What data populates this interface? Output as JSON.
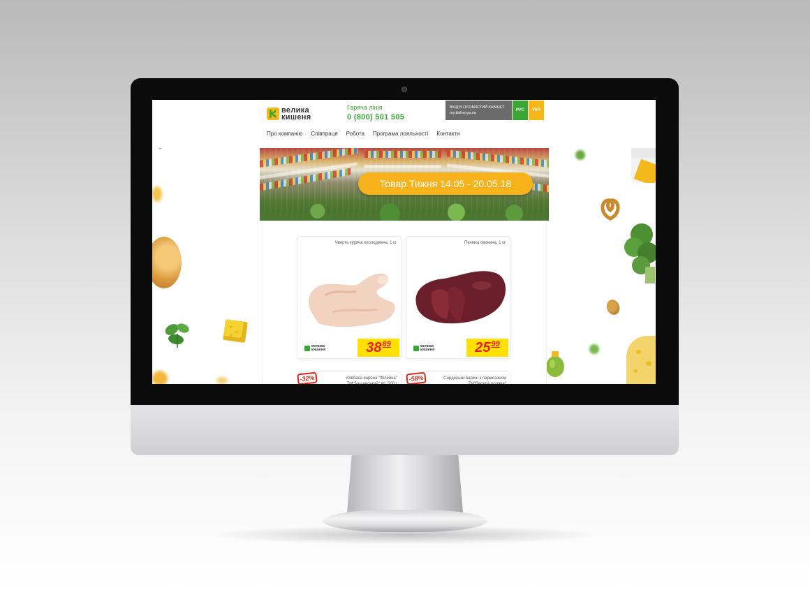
{
  "site": {
    "logo": {
      "line1": "велика",
      "line2": "кишеня"
    },
    "hotline": {
      "label": "Гаряча лінія",
      "phone": "0 (800) 501 505"
    },
    "cabinet": {
      "title": "ВХІД В ОСОБИСТИЙ КАБІНЕТ",
      "url": "my.kishenya.ua"
    },
    "languages": [
      "РУС",
      "УКР"
    ],
    "nav": [
      "Про компанію",
      "Співпраця",
      "Робота",
      "Програма лояльності",
      "Контакти"
    ],
    "banner": {
      "title": "Товар Тижня 14.05 - 20.05.18"
    },
    "products": [
      {
        "title": "Чверть куряча охолоджена, 1 кг",
        "price_int": "38",
        "price_dec": "89",
        "image_icon": "chicken-quarter-icon"
      },
      {
        "title": "Печінка свинина, 1 кг",
        "price_int": "25",
        "price_dec": "99",
        "image_icon": "pork-liver-icon"
      }
    ],
    "products_row2": [
      {
        "title": "Ковбаса варена \"Філейна\" ТМ\"Бащинський\" в/г, 500 г",
        "badge": "-32%"
      },
      {
        "title": "Сардельки варені з пармезаном ТМ\"Весела поляна\"",
        "badge": "-58%"
      }
    ]
  },
  "colors": {
    "brand_green": "#3aa535",
    "brand_yellow": "#f5b81a",
    "price_yellow": "#ffe000",
    "price_red": "#e2231a"
  }
}
